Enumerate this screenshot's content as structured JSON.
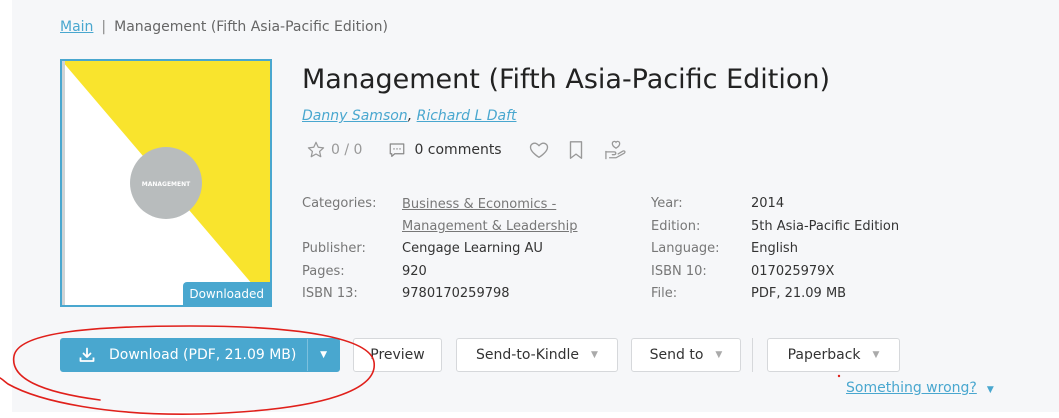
{
  "breadcrumb": {
    "home": "Main",
    "separator": "|",
    "current": "Management (Fifth Asia-Pacific Edition)"
  },
  "cover": {
    "text": "MANAGEMENT",
    "badge": "Downloaded",
    "colors": {
      "yellow": "#f9e42d",
      "circle": "#b8bcbd",
      "accent": "#49a7cf"
    }
  },
  "book": {
    "title": "Management (Fifth Asia-Pacific Edition)",
    "authors": [
      "Danny Samson",
      "Richard L Daft"
    ],
    "author_separator": ",",
    "rating": "0 / 0",
    "comments": "0 comments"
  },
  "details": {
    "left": [
      {
        "label": "Categories:",
        "value": "Business & Economics - Management & Leadership"
      },
      {
        "label": "Publisher:",
        "value": "Cengage Learning AU"
      },
      {
        "label": "Pages:",
        "value": "920"
      },
      {
        "label": "ISBN 13:",
        "value": "9780170259798"
      }
    ],
    "category_lines": [
      "Business & Economics -",
      "Management & Leadership"
    ],
    "right": [
      {
        "label": "Year:",
        "value": "2014"
      },
      {
        "label": "Edition:",
        "value": "5th Asia-Pacific Edition"
      },
      {
        "label": "Language:",
        "value": "English"
      },
      {
        "label": "ISBN 10:",
        "value": "017025979X"
      },
      {
        "label": "File:",
        "value": "PDF, 21.09 MB"
      }
    ]
  },
  "actions": {
    "download": "Download (PDF, 21.09 MB)",
    "preview": "Preview",
    "send_to_kindle": "Send-to-Kindle",
    "send_to": "Send to",
    "paperback": "Paperback"
  },
  "something_wrong": "Something wrong?",
  "icons": [
    "star-icon",
    "comment-icon",
    "heart-icon",
    "bookmark-icon",
    "donate-hand-icon",
    "download-tray-icon",
    "caret-down-icon"
  ],
  "colors": {
    "accent": "#49a7cf",
    "annotation": "#e0201b"
  }
}
